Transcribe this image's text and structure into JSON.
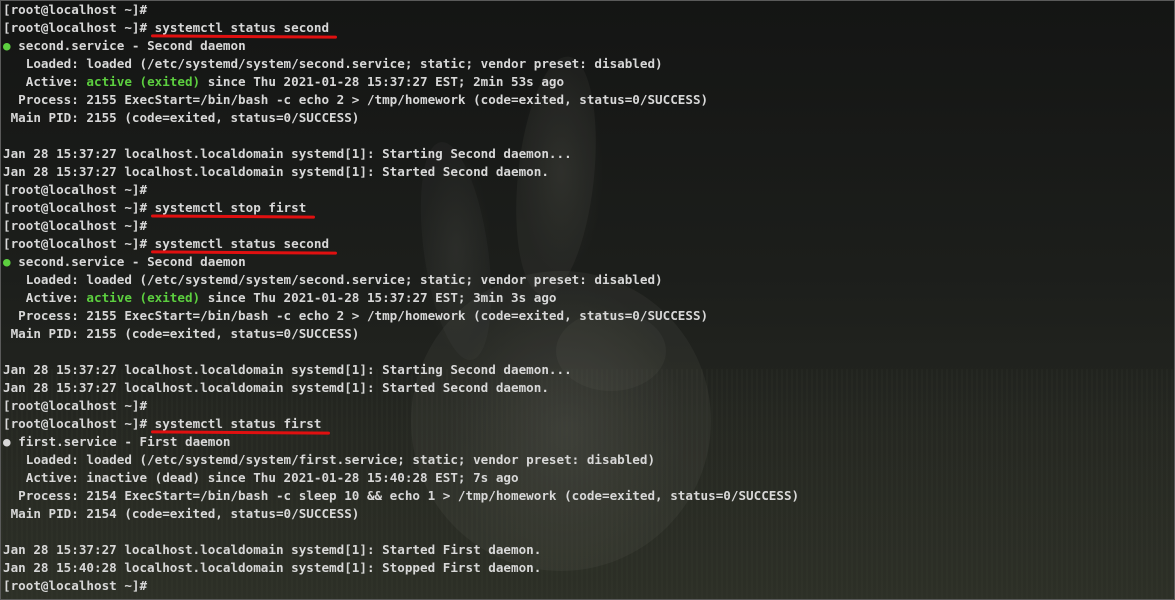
{
  "terminal": {
    "prompt": "[root@localhost ~]#",
    "lines": [
      {
        "type": "prompt",
        "cmd": ""
      },
      {
        "type": "prompt",
        "cmd": "systemctl status second",
        "underlined": true
      },
      {
        "type": "unit",
        "dot": "green",
        "text": "second.service - Second daemon"
      },
      {
        "type": "plain",
        "text": "   Loaded: loaded (/etc/systemd/system/second.service; static; vendor preset: disabled)"
      },
      {
        "type": "active",
        "prefix": "   Active: ",
        "state": "active (exited)",
        "green": true,
        "rest": " since Thu 2021-01-28 15:37:27 EST; 2min 53s ago"
      },
      {
        "type": "plain",
        "text": "  Process: 2155 ExecStart=/bin/bash -c echo 2 > /tmp/homework (code=exited, status=0/SUCCESS)"
      },
      {
        "type": "plain",
        "text": " Main PID: 2155 (code=exited, status=0/SUCCESS)"
      },
      {
        "type": "plain",
        "text": ""
      },
      {
        "type": "plain",
        "text": "Jan 28 15:37:27 localhost.localdomain systemd[1]: Starting Second daemon..."
      },
      {
        "type": "plain",
        "text": "Jan 28 15:37:27 localhost.localdomain systemd[1]: Started Second daemon."
      },
      {
        "type": "prompt",
        "cmd": ""
      },
      {
        "type": "prompt",
        "cmd": "systemctl stop first",
        "underlined": true
      },
      {
        "type": "prompt",
        "cmd": ""
      },
      {
        "type": "prompt",
        "cmd": "systemctl status second",
        "underlined": true
      },
      {
        "type": "unit",
        "dot": "green",
        "text": "second.service - Second daemon"
      },
      {
        "type": "plain",
        "text": "   Loaded: loaded (/etc/systemd/system/second.service; static; vendor preset: disabled)"
      },
      {
        "type": "active",
        "prefix": "   Active: ",
        "state": "active (exited)",
        "green": true,
        "rest": " since Thu 2021-01-28 15:37:27 EST; 3min 3s ago"
      },
      {
        "type": "plain",
        "text": "  Process: 2155 ExecStart=/bin/bash -c echo 2 > /tmp/homework (code=exited, status=0/SUCCESS)"
      },
      {
        "type": "plain",
        "text": " Main PID: 2155 (code=exited, status=0/SUCCESS)"
      },
      {
        "type": "plain",
        "text": ""
      },
      {
        "type": "plain",
        "text": "Jan 28 15:37:27 localhost.localdomain systemd[1]: Starting Second daemon..."
      },
      {
        "type": "plain",
        "text": "Jan 28 15:37:27 localhost.localdomain systemd[1]: Started Second daemon."
      },
      {
        "type": "prompt",
        "cmd": ""
      },
      {
        "type": "prompt",
        "cmd": "systemctl status first",
        "underlined": true
      },
      {
        "type": "unit",
        "dot": "white",
        "text": "first.service - First daemon"
      },
      {
        "type": "plain",
        "text": "   Loaded: loaded (/etc/systemd/system/first.service; static; vendor preset: disabled)"
      },
      {
        "type": "active",
        "prefix": "   Active: ",
        "state": "inactive (dead)",
        "green": false,
        "rest": " since Thu 2021-01-28 15:40:28 EST; 7s ago"
      },
      {
        "type": "plain",
        "text": "  Process: 2154 ExecStart=/bin/bash -c sleep 10 && echo 1 > /tmp/homework (code=exited, status=0/SUCCESS)"
      },
      {
        "type": "plain",
        "text": " Main PID: 2154 (code=exited, status=0/SUCCESS)"
      },
      {
        "type": "plain",
        "text": ""
      },
      {
        "type": "plain",
        "text": "Jan 28 15:37:27 localhost.localdomain systemd[1]: Started First daemon."
      },
      {
        "type": "plain",
        "text": "Jan 28 15:40:28 localhost.localdomain systemd[1]: Stopped First daemon."
      },
      {
        "type": "prompt",
        "cmd": ""
      }
    ],
    "bullet": "●",
    "colors": {
      "text": "#d8d8d8",
      "active_green": "#5ccf3f",
      "annotation_red": "#e01010",
      "background": "#1a1c1a"
    }
  }
}
